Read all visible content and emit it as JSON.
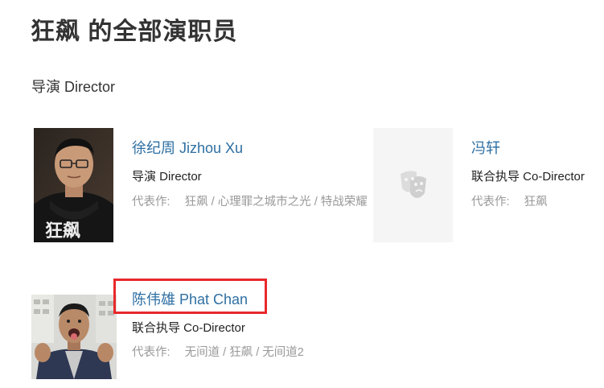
{
  "page": {
    "title": "狂飙 的全部演职员"
  },
  "section": {
    "title": "导演 Director"
  },
  "people": [
    {
      "name": "徐纪周 Jizhou Xu",
      "role": "导演 Director",
      "works_label": "代表作:",
      "works": [
        "狂飙",
        "心理罪之城市之光",
        "特战荣耀"
      ]
    },
    {
      "name": "冯轩",
      "role": "联合执导 Co-Director",
      "works_label": "代表作:",
      "works": [
        "狂飙"
      ]
    },
    {
      "name": "陈伟雄 Phat Chan",
      "role": "联合执导 Co-Director",
      "works_label": "代表作:",
      "works": [
        "无间道",
        "狂飙",
        "无间道2"
      ]
    }
  ],
  "icons": {
    "placeholder_photo": "theater-masks-icon"
  },
  "colors": {
    "link": "#2e6fa3",
    "muted": "#999999",
    "highlight": "#e8282b"
  }
}
